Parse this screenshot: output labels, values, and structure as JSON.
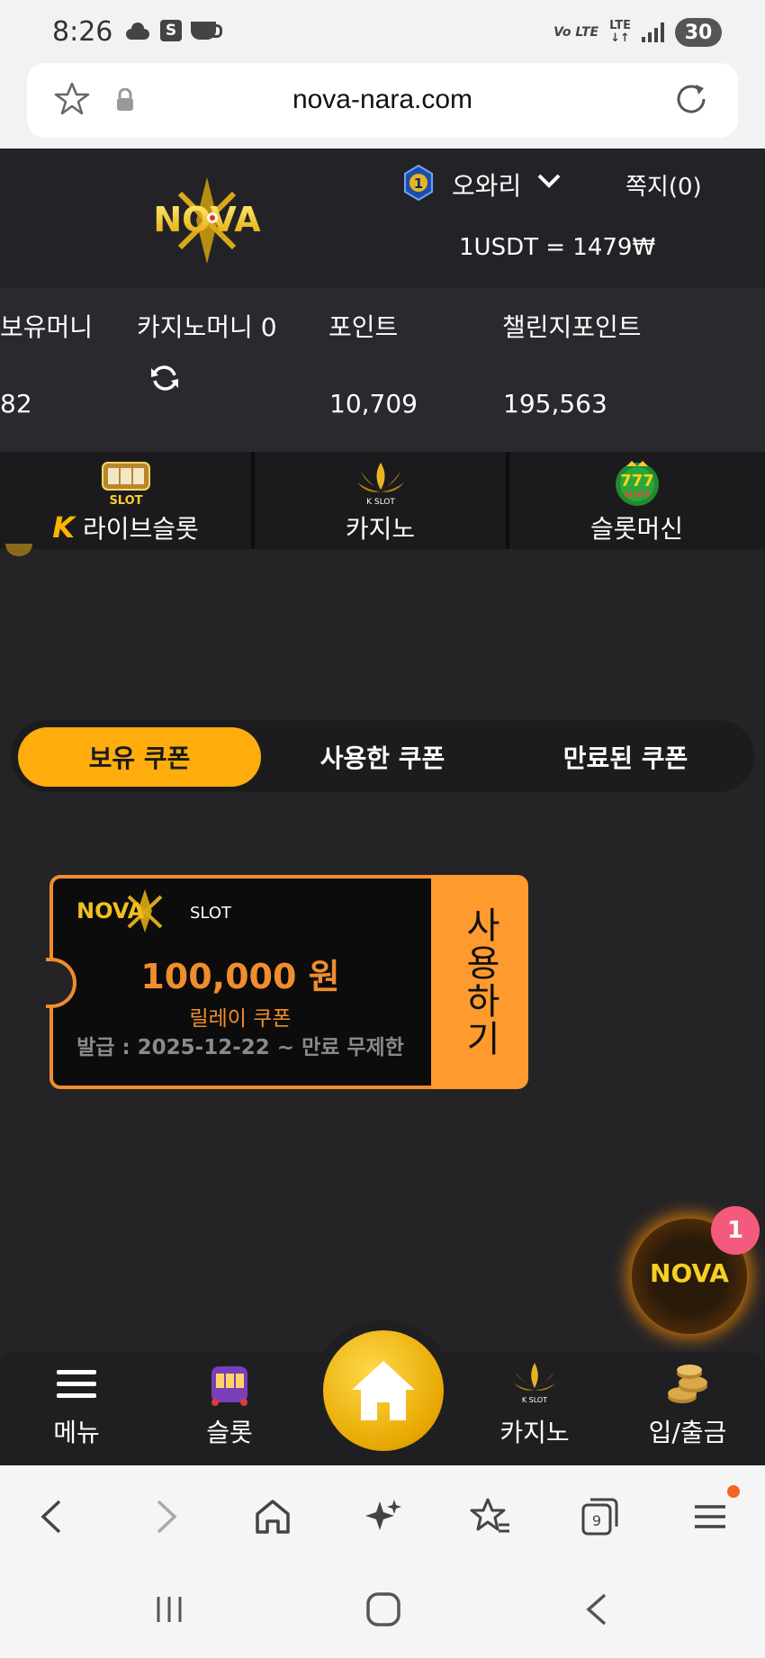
{
  "status_bar": {
    "time": "8:26",
    "network_volte": "Vo LTE",
    "network_lte": "LTE",
    "battery": "30"
  },
  "browser": {
    "url": "nova-nara.com",
    "tabs_count": "9"
  },
  "header": {
    "logo_text": "NOVA",
    "rank_level": "1",
    "username": "오와리",
    "messages": "쪽지(0)",
    "exchange_rate": "1USDT = 1479₩"
  },
  "balance": {
    "money_label": "보유머니",
    "money_value": "82",
    "casino_money_label": "카지노머니 0",
    "points_label": "포인트",
    "points_value": "10,709",
    "challenge_label": "챌린지포인트",
    "challenge_value": "195,563"
  },
  "game_tabs": [
    {
      "label": "라이브슬롯",
      "prefix": "K",
      "icon": "live-slot-icon"
    },
    {
      "label": "카지노",
      "icon": "k-slot-icon"
    },
    {
      "label": "슬롯머신",
      "icon": "777-slots-icon"
    }
  ],
  "coupon_tabs": [
    {
      "label": "보유 쿠폰",
      "active": true
    },
    {
      "label": "사용한 쿠폰",
      "active": false
    },
    {
      "label": "만료된 쿠폰",
      "active": false
    }
  ],
  "coupon": {
    "brand": "NOVA",
    "brand_suffix": "SLOT",
    "amount": "100,000 원",
    "type": "릴레이 쿠폰",
    "issued": "발급 : 2025-12-22 ~ 만료 무제한",
    "use_label": "사용하기"
  },
  "floating": {
    "logo_text": "NOVA",
    "badge": "1"
  },
  "bottom_nav": {
    "menu": "메뉴",
    "slot": "슬롯",
    "casino": "카지노",
    "deposit": "입/출금"
  },
  "colors": {
    "accent": "#ffad0d",
    "coupon_orange": "#f08d2d",
    "background": "#242326",
    "badge_pink": "#f45a7c"
  }
}
